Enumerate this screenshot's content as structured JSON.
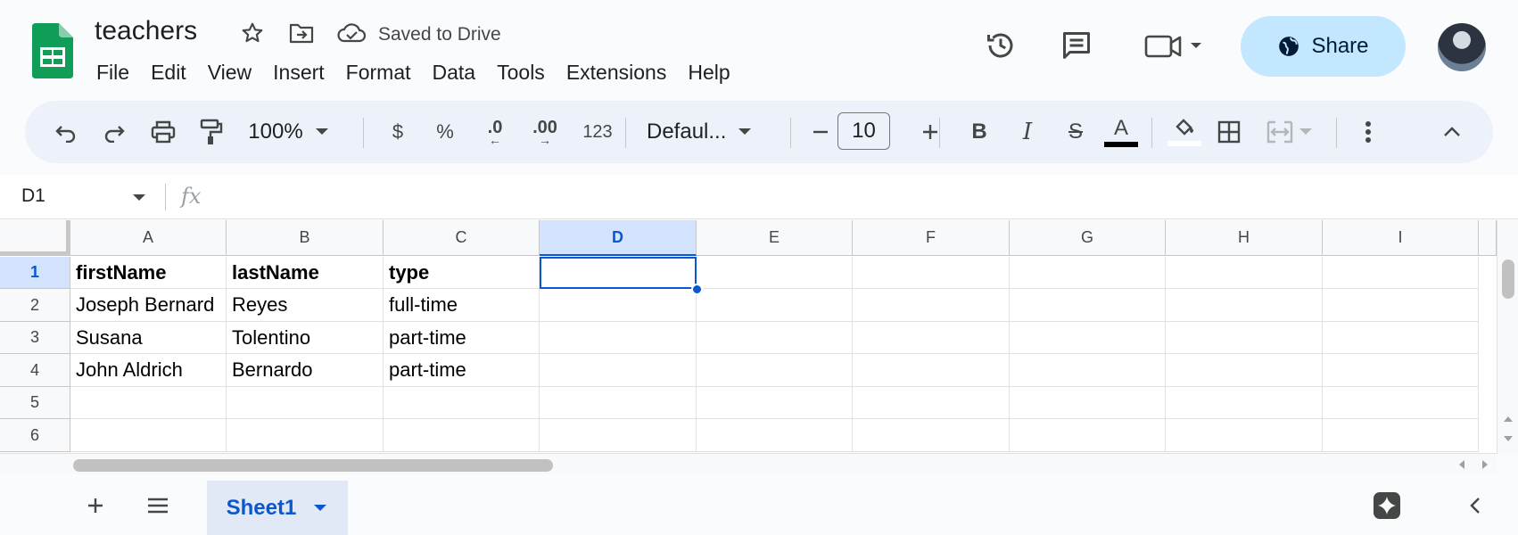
{
  "header": {
    "title": "teachers",
    "save_status": "Saved to Drive",
    "share_label": "Share"
  },
  "menu": [
    "File",
    "Edit",
    "View",
    "Insert",
    "Format",
    "Data",
    "Tools",
    "Extensions",
    "Help"
  ],
  "toolbar": {
    "zoom": "100%",
    "currency": "$",
    "percent": "%",
    "decrease_decimal": ".0",
    "increase_decimal": ".00",
    "number_format": "123",
    "font": "Defaul...",
    "font_size": "10"
  },
  "formula_bar": {
    "cell_ref": "D1",
    "fx": "fx",
    "value": ""
  },
  "grid": {
    "columns": [
      "A",
      "B",
      "C",
      "D",
      "E",
      "F",
      "G",
      "H",
      "I"
    ],
    "selected_column": "D",
    "rows": [
      "1",
      "2",
      "3",
      "4",
      "5",
      "6"
    ],
    "selected_row": "1",
    "cells": [
      [
        "firstName",
        "lastName",
        "type"
      ],
      [
        "Joseph Bernard",
        "Reyes",
        "full-time"
      ],
      [
        "Susana",
        "Tolentino",
        "part-time"
      ],
      [
        "John Aldrich",
        "Bernardo",
        "part-time"
      ],
      [
        "",
        "",
        ""
      ],
      [
        "",
        "",
        ""
      ]
    ]
  },
  "sheets": {
    "active": "Sheet1"
  },
  "colors": {
    "accent": "#0b57d0",
    "share_bg": "#c2e7ff",
    "selected_header": "#d3e3fd",
    "logo_green": "#0f9d58"
  }
}
